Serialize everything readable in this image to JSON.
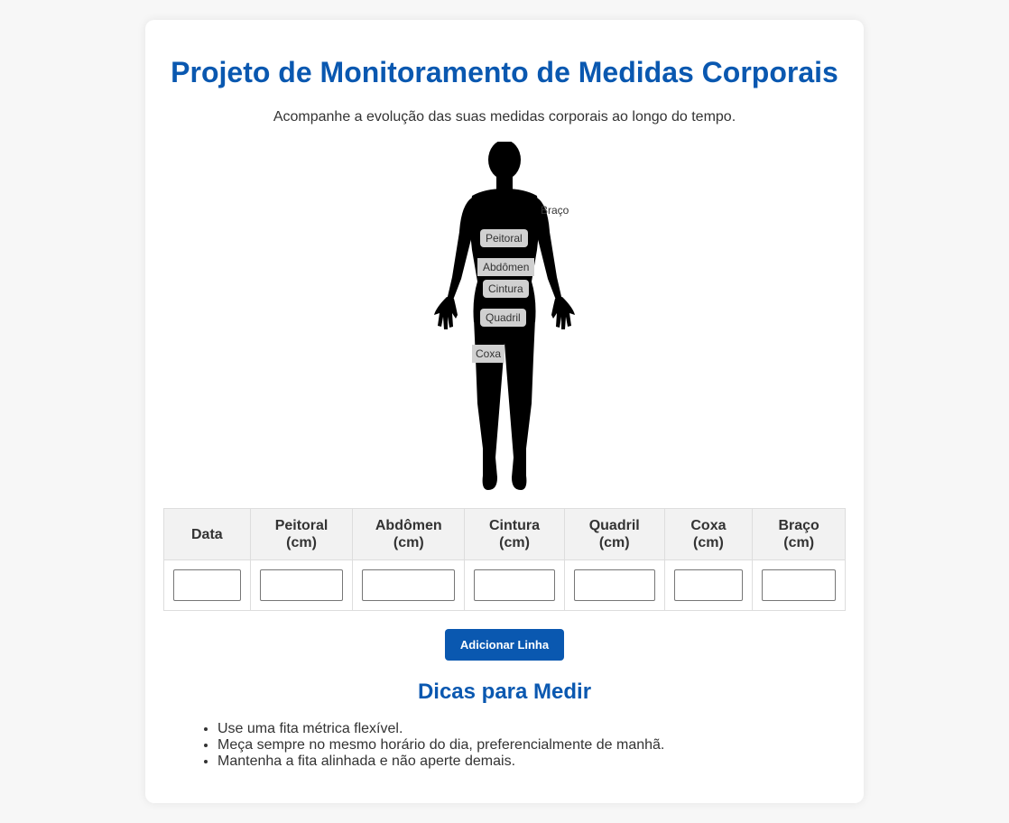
{
  "header": {
    "title": "Projeto de Monitoramento de Medidas Corporais",
    "subtitle": "Acompanhe a evolução das suas medidas corporais ao longo do tempo."
  },
  "figure": {
    "labels": {
      "braco": "Braço",
      "peitoral": "Peitoral",
      "abdomen": "Abdômen",
      "cintura": "Cintura",
      "quadril": "Quadril",
      "coxa": "Coxa"
    }
  },
  "table": {
    "headers": [
      [
        "Data"
      ],
      [
        "Peitoral",
        "(cm)"
      ],
      [
        "Abdômen",
        "(cm)"
      ],
      [
        "Cintura",
        "(cm)"
      ],
      [
        "Quadril",
        "(cm)"
      ],
      [
        "Coxa",
        "(cm)"
      ],
      [
        "Braço",
        "(cm)"
      ]
    ],
    "row": [
      "",
      "",
      "",
      "",
      "",
      "",
      ""
    ]
  },
  "add_button_label": "Adicionar Linha",
  "tips": {
    "title": "Dicas para Medir",
    "items": [
      "Use uma fita métrica flexível.",
      "Meça sempre no mesmo horário do dia, preferencialmente de manhã.",
      "Mantenha a fita alinhada e não aperte demais."
    ]
  },
  "colors": {
    "accent": "#0a58b0",
    "page_bg": "#f7f7f7",
    "card_bg": "#ffffff",
    "header_bg": "#f2f2f2"
  }
}
